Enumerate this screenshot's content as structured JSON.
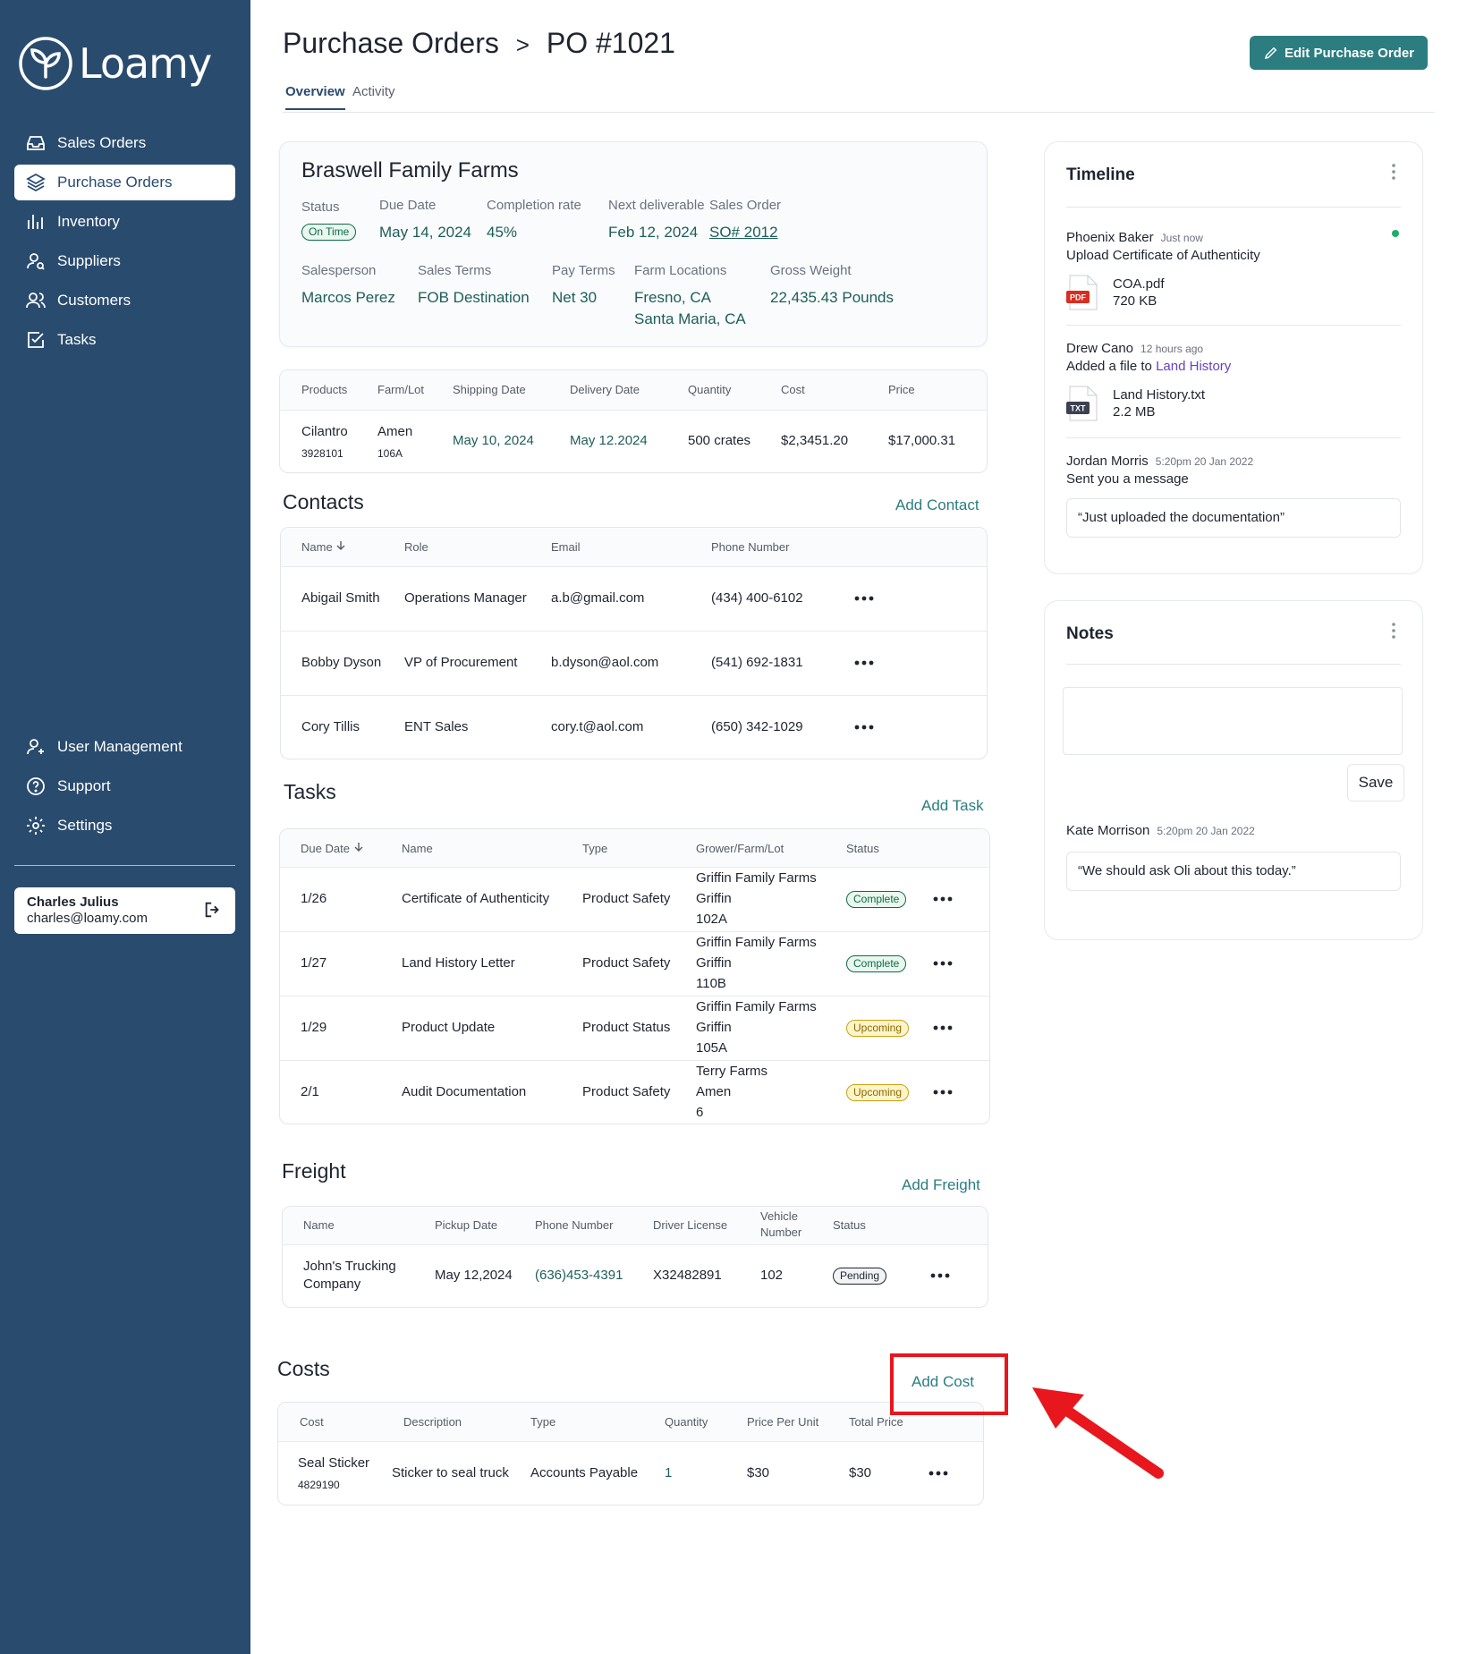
{
  "app": {
    "name": "Loamy"
  },
  "sidebar": {
    "items": [
      {
        "label": "Sales Orders",
        "icon": "inbox-icon"
      },
      {
        "label": "Purchase Orders",
        "icon": "layers-icon"
      },
      {
        "label": "Inventory",
        "icon": "bar-chart-icon"
      },
      {
        "label": "Suppliers",
        "icon": "user-search-icon"
      },
      {
        "label": "Customers",
        "icon": "users-icon"
      },
      {
        "label": "Tasks",
        "icon": "checkbox-icon"
      }
    ],
    "bottom_items": [
      {
        "label": "User Management",
        "icon": "user-plus-icon"
      },
      {
        "label": "Support",
        "icon": "help-circle-icon"
      },
      {
        "label": "Settings",
        "icon": "gear-icon"
      }
    ],
    "user": {
      "name": "Charles Julius",
      "email": "charles@loamy.com"
    }
  },
  "header": {
    "breadcrumb_parent": "Purchase Orders",
    "separator": ">",
    "breadcrumb_current": "PO #1021",
    "edit_button": "Edit Purchase Order",
    "tabs": [
      "Overview",
      "Activity"
    ]
  },
  "summary": {
    "farm": "Braswell Family Farms",
    "status_label": "Status",
    "status_value": "On Time",
    "due_label": "Due Date",
    "due_value": "May 14, 2024",
    "completion_label": "Completion rate",
    "completion_value": "45%",
    "next_label": "Next deliverable",
    "next_value": "Feb 12, 2024",
    "so_label": "Sales Order",
    "so_value": "SO# 2012",
    "salesperson_label": "Salesperson",
    "salesperson_value": "Marcos Perez",
    "sales_terms_label": "Sales Terms",
    "sales_terms_value": "FOB Destination",
    "pay_terms_label": "Pay Terms",
    "pay_terms_value": "Net 30",
    "locations_label": "Farm Locations",
    "location_1": "Fresno, CA",
    "location_2": "Santa Maria, CA",
    "weight_label": "Gross Weight",
    "weight_value": "22,435.43 Pounds"
  },
  "products": {
    "headers": [
      "Products",
      "Farm/Lot",
      "Shipping Date",
      "Delivery Date",
      "Quantity",
      "Cost",
      "Price"
    ],
    "row": {
      "product": "Cilantro",
      "product_id": "3928101",
      "farm": "Amen",
      "lot": "106A",
      "ship": "May 10, 2024",
      "delivery": "May 12.2024",
      "qty": "500 crates",
      "cost": "$2,3451.20",
      "price": "$17,000.31"
    }
  },
  "contacts": {
    "title": "Contacts",
    "add": "Add Contact",
    "headers": [
      "Name",
      "Role",
      "Email",
      "Phone Number"
    ],
    "rows": [
      {
        "name": "Abigail Smith",
        "role": "Operations Manager",
        "email": "a.b@gmail.com",
        "phone": "(434) 400-6102"
      },
      {
        "name": "Bobby Dyson",
        "role": "VP of Procurement",
        "email": "b.dyson@aol.com",
        "phone": "(541) 692-1831"
      },
      {
        "name": "Cory Tillis",
        "role": "ENT Sales",
        "email": "cory.t@aol.com",
        "phone": "(650) 342-1029"
      }
    ]
  },
  "tasks": {
    "title": "Tasks",
    "add": "Add Task",
    "headers": [
      "Due Date",
      "Name",
      "Type",
      "Grower/Farm/Lot",
      "Status"
    ],
    "rows": [
      {
        "due": "1/26",
        "name": "Certificate of Authenticity",
        "type": "Product Safety",
        "grower": "Griffin Family Farms",
        "farm": "Griffin",
        "lot": "102A",
        "status": "Complete"
      },
      {
        "due": "1/27",
        "name": "Land History Letter",
        "type": "Product Safety",
        "grower": "Griffin Family Farms",
        "farm": "Griffin",
        "lot": "110B",
        "status": "Complete"
      },
      {
        "due": "1/29",
        "name": "Product Update",
        "type": "Product Status",
        "grower": "Griffin Family Farms",
        "farm": "Griffin",
        "lot": "105A",
        "status": "Upcoming"
      },
      {
        "due": "2/1",
        "name": "Audit Documentation",
        "type": "Product Safety",
        "grower": "Terry Farms",
        "farm": "Amen",
        "lot": "6",
        "status": "Upcoming"
      }
    ]
  },
  "freight": {
    "title": "Freight",
    "add": "Add Freight",
    "headers": [
      "Name",
      "Pickup Date",
      "Phone Number",
      "Driver License",
      "Vehicle",
      "Number",
      "Status"
    ],
    "row": {
      "name_1": "John's Trucking",
      "name_2": "Company",
      "pickup": "May 12,2024",
      "phone": "(636)453-4391",
      "license": "X32482891",
      "vehicle": "102",
      "status": "Pending"
    }
  },
  "costs": {
    "title": "Costs",
    "add": "Add Cost",
    "headers": [
      "Cost",
      "Description",
      "Type",
      "Quantity",
      "Price Per Unit",
      "Total Price"
    ],
    "row": {
      "cost": "Seal Sticker",
      "cost_id": "4829190",
      "description": "Sticker to seal truck",
      "type": "Accounts Payable",
      "qty": "1",
      "ppu": "$30",
      "total": "$30"
    }
  },
  "timeline": {
    "title": "Timeline",
    "entries": [
      {
        "name": "Phoenix Baker",
        "time": "Just now",
        "text": "Upload Certificate of Authenticity",
        "file": "COA.pdf",
        "size": "720 KB",
        "file_type": "PDF"
      },
      {
        "name": "Drew Cano",
        "time": "12 hours ago",
        "text_pre": "Added a file to",
        "text_link": "Land History",
        "file": "Land History.txt",
        "size": "2.2 MB",
        "file_type": "TXT"
      },
      {
        "name": "Jordan Morris",
        "time": "5:20pm 20 Jan 2022",
        "text": "Sent you a message",
        "quote": "“Just uploaded the documentation”"
      }
    ]
  },
  "notes": {
    "title": "Notes",
    "save": "Save",
    "entry": {
      "name": "Kate Morrison",
      "time": "5:20pm 20 Jan 2022",
      "quote": "“We should ask Oli about this today.”"
    }
  },
  "colors": {
    "sidebar": "#294b6e",
    "accent": "#2b7d80",
    "highlight": "#e8161d",
    "online": "#1fae6a"
  }
}
